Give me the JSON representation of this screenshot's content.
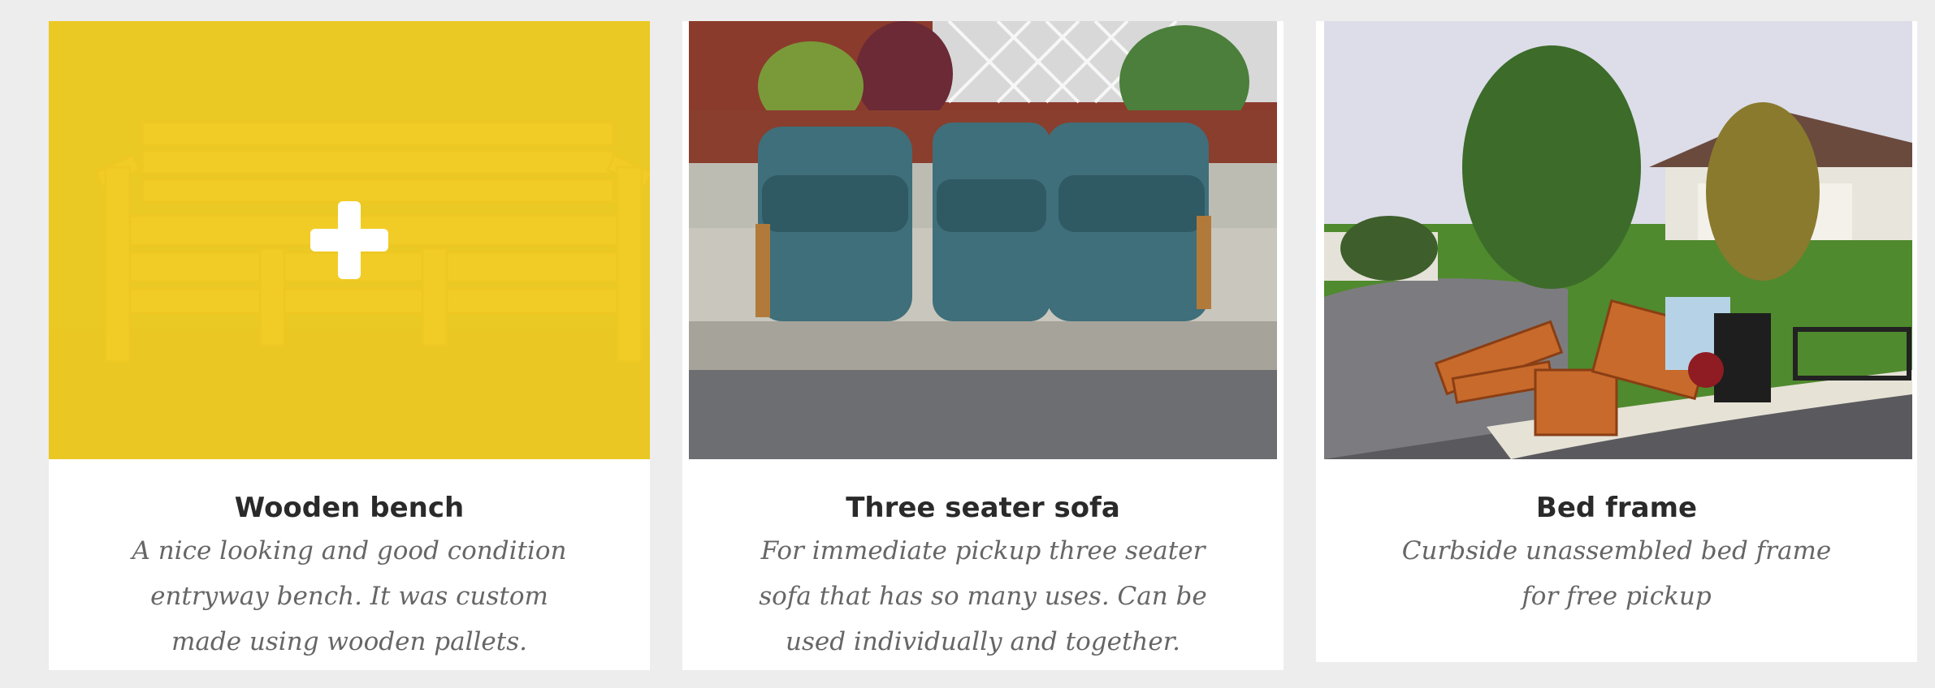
{
  "listings": [
    {
      "title": "Wooden bench",
      "description": "A nice looking and good condition entryway bench. It was custom made using wooden pallets.",
      "image": "wooden-bench-photo",
      "hovered": true
    },
    {
      "title": "Three seater sofa",
      "description": "For immediate pickup three seater sofa that has so many uses. Can be used individually and together.",
      "image": "blue-recliner-sofa-photo",
      "hovered": false
    },
    {
      "title": "Bed frame",
      "description": "Curbside unassembled bed frame for free pickup",
      "image": "curbside-bed-frame-photo",
      "hovered": false
    }
  ],
  "colors": {
    "page_background": "#ededed",
    "card_background": "#ffffff",
    "hover_overlay": "#f5cf22",
    "title_text": "#2a2a2a",
    "description_text": "#666666"
  },
  "icons": {
    "hover_add": "plus-icon"
  }
}
